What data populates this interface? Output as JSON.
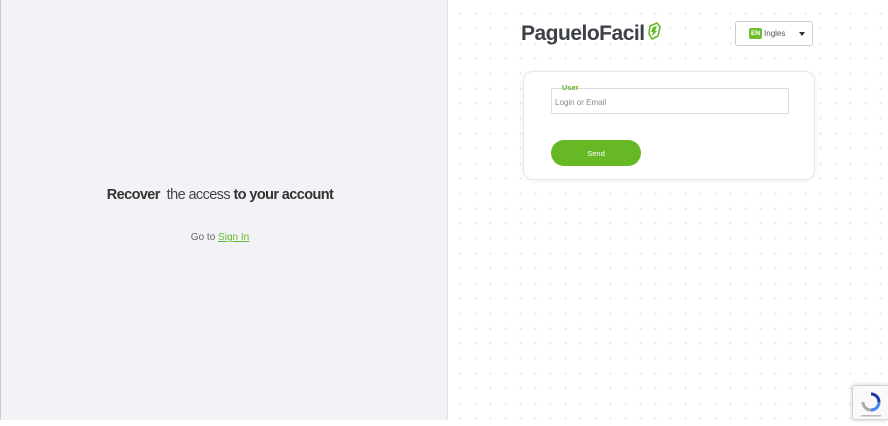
{
  "left_panel": {
    "headline": {
      "part1": "Recover",
      "part2": "the access",
      "part3": "to your account"
    },
    "goto_prefix": "Go to",
    "signin_link": "Sign In"
  },
  "brand": {
    "logo_text": "PagueloFacil",
    "accent_color": "#66b825"
  },
  "language": {
    "flag": "EN",
    "label": "Ingles"
  },
  "form": {
    "user_label": "User",
    "user_placeholder": "Login or Email",
    "user_value": "",
    "send_label": "Send"
  }
}
